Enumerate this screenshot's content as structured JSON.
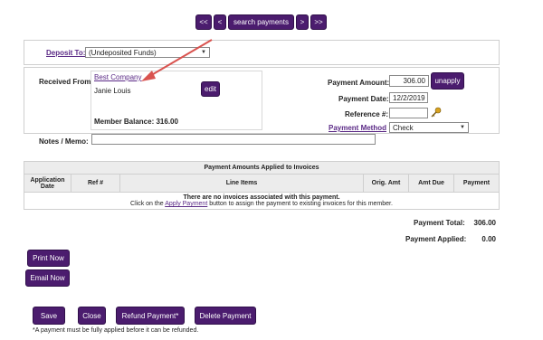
{
  "nav": {
    "first": "<<",
    "prev": "<",
    "search": "search payments",
    "next": ">",
    "last": ">>"
  },
  "deposit": {
    "label": "Deposit To:",
    "value": "(Undeposited Funds)"
  },
  "received": {
    "label": "Received From:",
    "company": "Best Company",
    "person": "Janie Louis",
    "edit": "edit",
    "balance_label": "Member Balance:",
    "balance_value": "316.00"
  },
  "payment": {
    "amount_label": "Payment Amount:",
    "amount_value": "306.00",
    "unapply": "unapply",
    "date_label": "Payment Date:",
    "date_value": "12/2/2019",
    "reference_label": "Reference #:",
    "reference_value": "",
    "method_label": "Payment Method",
    "method_value": "Check"
  },
  "notes": {
    "label": "Notes / Memo:",
    "value": ""
  },
  "table": {
    "title": "Payment Amounts Applied to Invoices",
    "columns": [
      "Application Date",
      "Ref #",
      "Line Items",
      "Orig. Amt",
      "Amt Due",
      "Payment"
    ],
    "empty_message": "There are no invoices associated with this payment.",
    "hint_before": "Click on the ",
    "hint_link": "Apply Payment",
    "hint_after": " button to assign the payment to existing invoices for this member."
  },
  "totals": {
    "total_label": "Payment Total:",
    "total_value": "306.00",
    "applied_label": "Payment Applied:",
    "applied_value": "0.00"
  },
  "actions": {
    "print": "Print Now",
    "email": "Email Now",
    "save": "Save",
    "close": "Close",
    "refund": "Refund Payment*",
    "delete": "Delete Payment"
  },
  "footnote": "*A payment must be fully applied before it can be refunded.",
  "colors": {
    "accent": "#4b1c6e",
    "link": "#5b2a86",
    "arrow": "#d9534f"
  }
}
